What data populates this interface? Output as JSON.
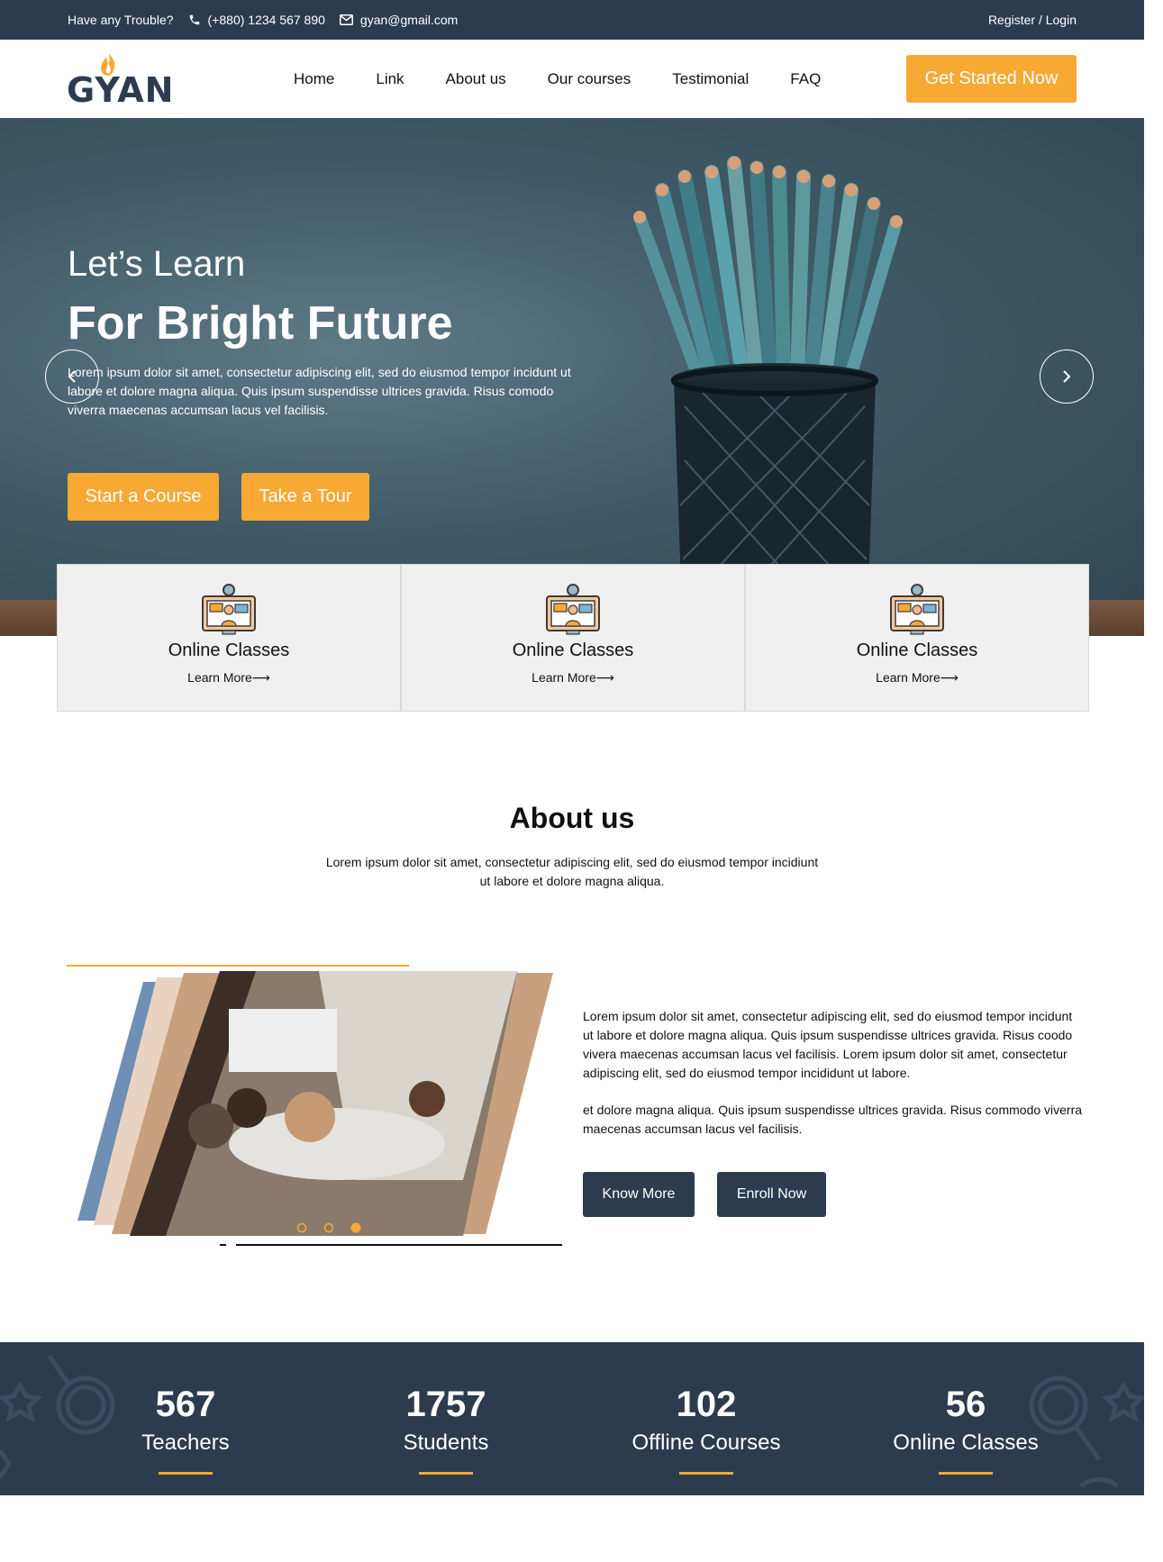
{
  "topbar": {
    "trouble_text": "Have any Trouble?",
    "phone": "(+880) 1234 567 890",
    "email": "gyan@gmail.com",
    "auth_link": "Register / Login"
  },
  "brand": {
    "logo_text": "GYAN"
  },
  "nav": {
    "items": [
      "Home",
      "Link",
      "About us",
      "Our courses",
      "Testimonial",
      "FAQ"
    ],
    "cta": "Get Started Now"
  },
  "hero": {
    "subtitle": "Let’s Learn",
    "title": "For Bright Future",
    "description": "Lorem ipsum dolor sit amet, consectetur adipiscing elit, sed do eiusmod tempor incidunt ut labore et dolore magna aliqua. Quis ipsum suspendisse ultrices gravida. Risus comodo viverra maecenas accumsan lacus vel facilisis.",
    "primary_button": "Start a Course",
    "secondary_button": "Take a Tour"
  },
  "features": [
    {
      "title": "Online Classes",
      "link": "Learn More⟶",
      "icon": "online-class-icon"
    },
    {
      "title": "Online Classes",
      "link": "Learn More⟶",
      "icon": "online-class-icon"
    },
    {
      "title": "Online Classes",
      "link": "Learn More⟶",
      "icon": "online-class-icon"
    }
  ],
  "about": {
    "title": "About us",
    "subtitle": "Lorem ipsum dolor sit amet, consectetur adipiscing elit, sed do eiusmod tempor incidiunt ut labore et dolore magna aliqua.",
    "paragraph1": "Lorem ipsum dolor sit amet, consectetur adipiscing elit, sed do eiusmod tempor incidunt ut labore et dolore magna aliqua. Quis ipsum suspendisse ultrices gravida. Risus coodo vivera maecenas accumsan lacus vel facilisis. Lorem ipsum dolor sit amet, consectetur adipiscing elit, sed do eiusmod tempor incididunt ut labore.",
    "paragraph2": "et dolore magna aliqua. Quis ipsum suspendisse ultrices gravida. Risus commodo viverra maecenas accumsan lacus vel facilisis.",
    "know_more": "Know More",
    "enroll": "Enroll Now",
    "carousel_active_dot": 3
  },
  "stats": [
    {
      "number": "567",
      "label": "Teachers"
    },
    {
      "number": "1757",
      "label": "Students"
    },
    {
      "number": "102",
      "label": "Offline Courses"
    },
    {
      "number": "56",
      "label": "Online Classes"
    }
  ],
  "colors": {
    "accent": "#f7a934",
    "dark": "#2d3b4f"
  }
}
